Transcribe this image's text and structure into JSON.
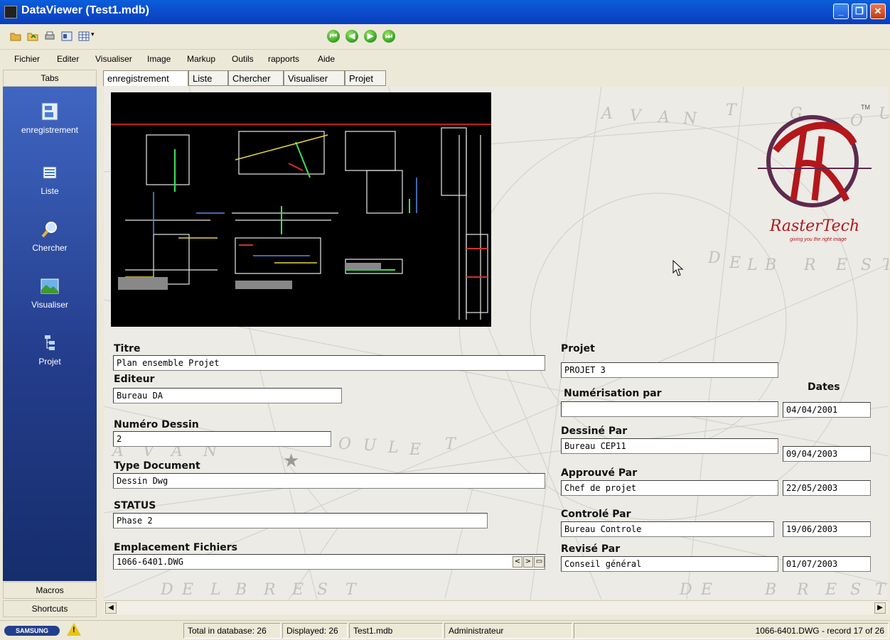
{
  "window": {
    "title": "DataViewer (Test1.mdb)"
  },
  "toolbar": {
    "icons": [
      "open-icon",
      "open-folder-icon",
      "print-icon",
      "view-icon",
      "grid-icon"
    ],
    "nav": [
      "first-record-icon",
      "previous-record-icon",
      "next-record-icon",
      "last-record-icon"
    ]
  },
  "menu": {
    "items": [
      "Fichier",
      "Editer",
      "Visualiser",
      "Image",
      "Markup",
      "Outils",
      "rapports",
      "Aide"
    ]
  },
  "sidebar": {
    "header": "Tabs",
    "items": [
      {
        "label": "enregistrement",
        "icon": "record-icon"
      },
      {
        "label": "Liste",
        "icon": "list-icon"
      },
      {
        "label": "Chercher",
        "icon": "search-icon"
      },
      {
        "label": "Visualiser",
        "icon": "image-icon"
      },
      {
        "label": "Projet",
        "icon": "tree-icon"
      }
    ],
    "macros": "Macros",
    "shortcuts": "Shortcuts"
  },
  "tabs": [
    "enregistrement",
    "Liste",
    "Chercher",
    "Visualiser",
    "Projet"
  ],
  "logo": {
    "brand": "RasterTech",
    "tm": "TM",
    "tagline": "giving you the right image"
  },
  "map_text": {
    "top": [
      "A",
      "V",
      "A",
      "N",
      "T",
      "G",
      "O",
      "U"
    ],
    "middle": [
      "D",
      "E",
      "L",
      "B",
      "R",
      "E",
      "S",
      "T"
    ],
    "left": [
      "A",
      "V",
      "A",
      "N"
    ],
    "mid2": [
      "O",
      "U",
      "L",
      "E",
      "T"
    ],
    "bottom": [
      "D",
      "E",
      "L",
      "B",
      "R",
      "E",
      "S",
      "T"
    ],
    "bottom2": [
      "D",
      "E",
      "B",
      "R",
      "E",
      "S",
      "T"
    ]
  },
  "form": {
    "titre": {
      "label": "Titre",
      "value": "Plan ensemble Projet"
    },
    "editeur": {
      "label": "Editeur",
      "value": "Bureau DA"
    },
    "numero": {
      "label": "Numéro Dessin",
      "value": "2"
    },
    "type": {
      "label": "Type Document",
      "value": "Dessin Dwg"
    },
    "status": {
      "label": "STATUS",
      "value": "Phase 2"
    },
    "emplacement": {
      "label": "Emplacement Fichiers",
      "value": "1066-6401.DWG"
    },
    "projet": {
      "label": "Projet",
      "value": "PROJET 3"
    },
    "dates_label": "Dates",
    "numerisation": {
      "label": "Numérisation par",
      "value": "",
      "date": "04/04/2001"
    },
    "dessine": {
      "label": "Dessiné Par",
      "value": "Bureau CEP11",
      "date": "09/04/2003"
    },
    "approuve": {
      "label": "Approuvé Par",
      "value": "Chef de projet",
      "date": "22/05/2003"
    },
    "controle": {
      "label": "Controlé Par",
      "value": "Bureau Controle",
      "date": "19/06/2003"
    },
    "revise": {
      "label": "Revisé Par",
      "value": "Conseil général",
      "date": "01/07/2003"
    },
    "prev_label": "<",
    "next_label": ">"
  },
  "status": {
    "brand": "SAMSUNG",
    "warning": "!",
    "total": "Total in database: 26",
    "displayed": "Displayed: 26",
    "file": "Test1.mdb",
    "user": "Administrateur",
    "record": "1066-6401.DWG - record 17 of 26"
  }
}
